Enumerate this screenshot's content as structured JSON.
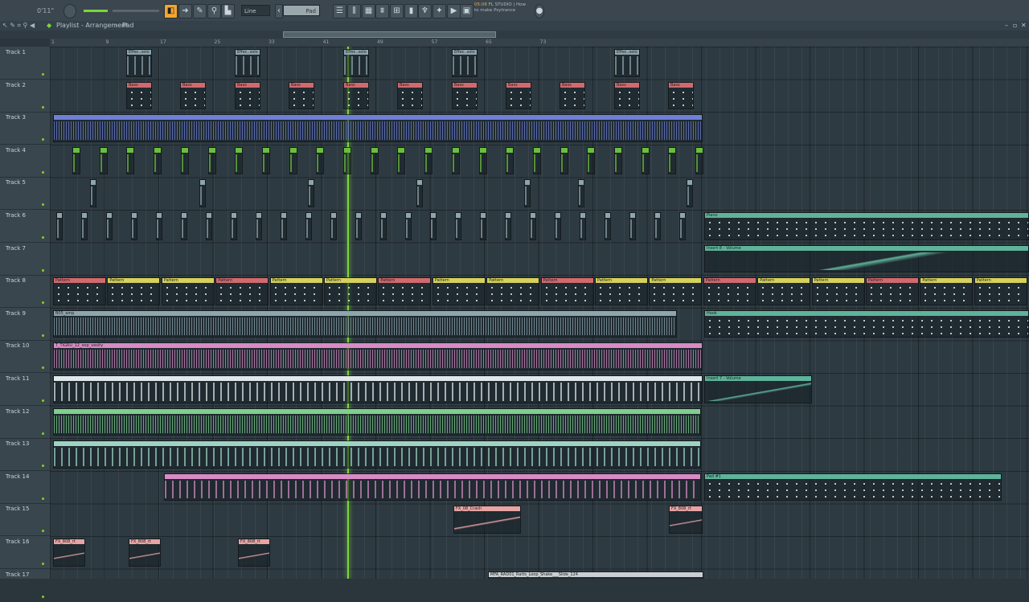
{
  "toolbar": {
    "time": "0'11\"",
    "tool_mode": "Line",
    "pattern_name": "Pad",
    "song_position": "05:08",
    "hint_title": "FL STUDIO | How",
    "hint_sub": "to make Psytrance"
  },
  "window": {
    "title": "Playlist - Arrangement",
    "pattern": "Pad"
  },
  "tracks": [
    "Track 1",
    "Track 2",
    "Track 3",
    "Track 4",
    "Track 5",
    "Track 6",
    "Track 7",
    "Track 8",
    "Track 9",
    "Track 10",
    "Track 11",
    "Track 12",
    "Track 13",
    "Track 14",
    "Track 15",
    "Track 16",
    "Track 17"
  ],
  "ruler_marks": [
    "1",
    "9",
    "17",
    "25",
    "33",
    "41",
    "49",
    "57",
    "65",
    "73"
  ],
  "clip_labels": {
    "effect": "Effec..solo",
    "bass": "Bass",
    "piano": "Piano",
    "insert_vol": "Insert 8 - Volume",
    "bass_vol": "BAS - Volume",
    "pattern": "Pattern",
    "amp": "B05_amp",
    "loop": "T_TIGRU_12_oop_vesity",
    "hook": "Hook",
    "insert7": "Insert 7 - Volume",
    "pad": "Pad #1",
    "crash": "FX_08_Crash",
    "fx808": "FX_808_rt",
    "shaker": "MFA_RAD01_Ratts_Loop_Shake___Slide_124"
  },
  "colors": {
    "accent_green": "#7cd63b",
    "clip_grey": "#8fa5ad",
    "clip_red": "#d06a6f",
    "clip_blue": "#6e7fd6",
    "clip_pink": "#d88bc4",
    "clip_yellow": "#d6d15c",
    "clip_teal": "#5fb39a"
  },
  "playhead_position_bar": 42
}
